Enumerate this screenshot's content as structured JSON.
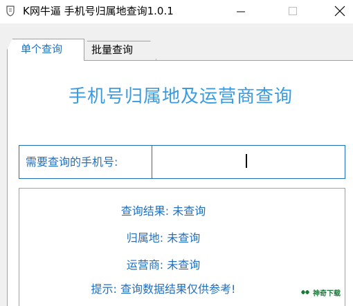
{
  "window": {
    "title": "K网牛逼 手机号归属地查询1.0.1",
    "app_icon": "shield-icon",
    "controls": {
      "minimize": "minimize-icon",
      "maximize": "maximize-icon",
      "close": "close-icon"
    }
  },
  "tabs": [
    {
      "label": "单个查询",
      "active": true
    },
    {
      "label": "批量查询",
      "active": false
    }
  ],
  "heading": "手机号归属地及运营商查询",
  "phone": {
    "label": "需要查询的手机号:",
    "value": "",
    "placeholder": ""
  },
  "results": {
    "query_result": "查询结果: 未查询",
    "location": "归属地: 未查询",
    "carrier": "运营商: 未查询",
    "tip": "提示: 查询数据结果仅供参考!"
  },
  "watermark": {
    "text": "神奇下载",
    "logo": "leaf-logo-icon"
  },
  "colors": {
    "accent": "#1e6fc0",
    "heading": "#3a9be0",
    "border": "#a0a0a0",
    "watermark": "#1a7a3a"
  }
}
